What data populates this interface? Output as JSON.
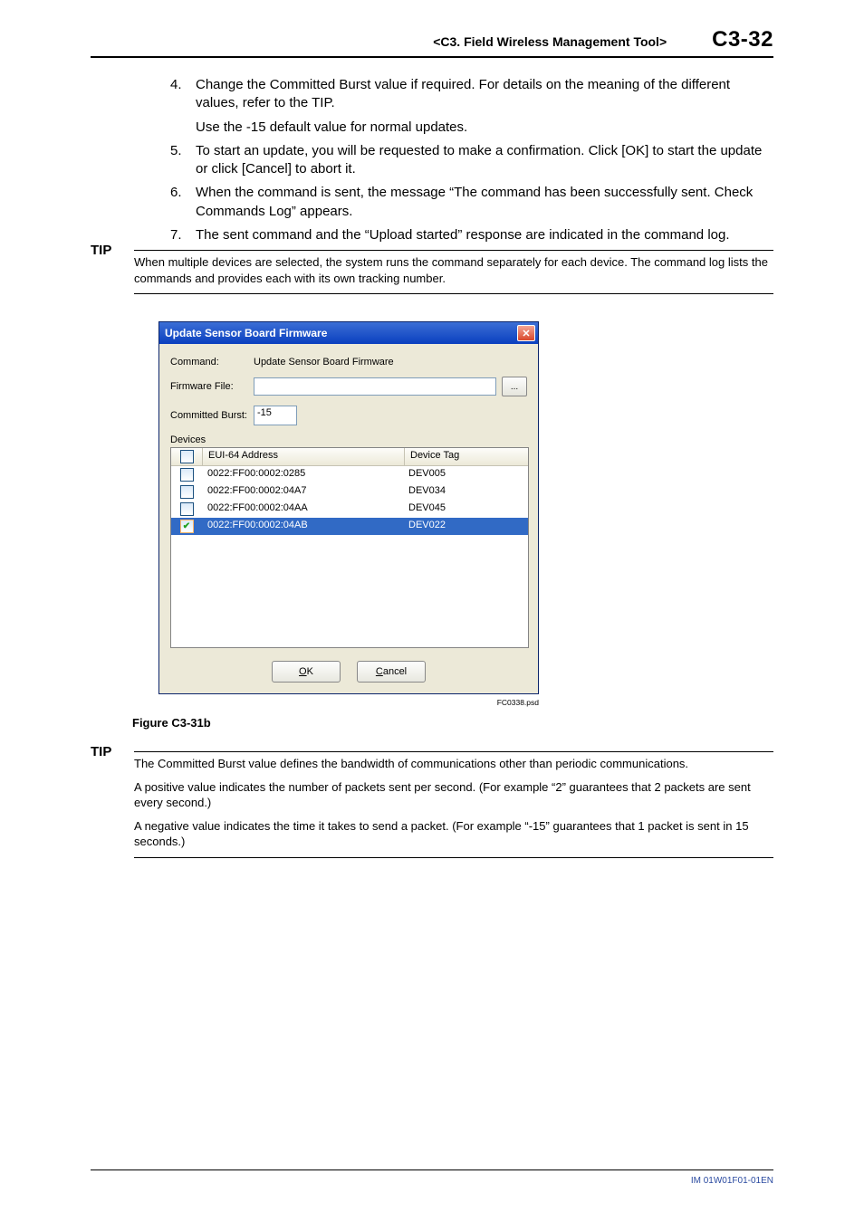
{
  "header": {
    "section": "<C3.  Field Wireless Management Tool>",
    "page": "C3-32"
  },
  "steps": [
    {
      "n": "4.",
      "text": "Change the Committed Burst value if required. For details on the meaning of the different values, refer to the TIP.",
      "sub": "Use the -15 default value for normal updates."
    },
    {
      "n": "5.",
      "text": "To start an update, you will be requested to make a confirmation. Click [OK] to start the update or click [Cancel] to abort it."
    },
    {
      "n": "6.",
      "text": "When the command is sent, the message “The command has been successfully sent. Check Commands Log” appears."
    },
    {
      "n": "7.",
      "text": "The sent command and the “Upload started” response are indicated in the command log."
    }
  ],
  "tip1": {
    "label": "TIP",
    "text": "When multiple devices are selected, the system runs the command separately for each device. The command log lists the commands and provides each with its own tracking number."
  },
  "dialog": {
    "title": "Update Sensor Board Firmware",
    "command_label": "Command:",
    "command_value": "Update Sensor Board Firmware",
    "firmware_label": "Firmware File:",
    "firmware_value": "",
    "browse": "...",
    "burst_label": "Committed Burst:",
    "burst_value": "-15",
    "devices_label": "Devices",
    "headers": {
      "eui": "EUI-64 Address",
      "tag": "Device Tag"
    },
    "rows": [
      {
        "eui": "0022:FF00:0002:0285",
        "tag": "DEV005",
        "checked": false,
        "selected": false
      },
      {
        "eui": "0022:FF00:0002:04A7",
        "tag": "DEV034",
        "checked": false,
        "selected": false
      },
      {
        "eui": "0022:FF00:0002:04AA",
        "tag": "DEV045",
        "checked": false,
        "selected": false
      },
      {
        "eui": "0022:FF00:0002:04AB",
        "tag": "DEV022",
        "checked": true,
        "selected": true
      }
    ],
    "ok": "OK",
    "cancel": "Cancel",
    "ok_hk": "O",
    "cancel_hk": "C"
  },
  "figure": {
    "ref": "FC0338.psd",
    "caption": "Figure C3-31b"
  },
  "tip2": {
    "label": "TIP",
    "p1": "The Committed Burst value defines the bandwidth of communications other than periodic communications.",
    "p2": "A positive value indicates the number of packets sent per second. (For example “2” guarantees that 2 packets are sent every second.)",
    "p3": "A negative value indicates the time it takes to send a packet. (For example “-15” guarantees that 1 packet is sent in 15 seconds.)"
  },
  "footer": "IM 01W01F01-01EN"
}
